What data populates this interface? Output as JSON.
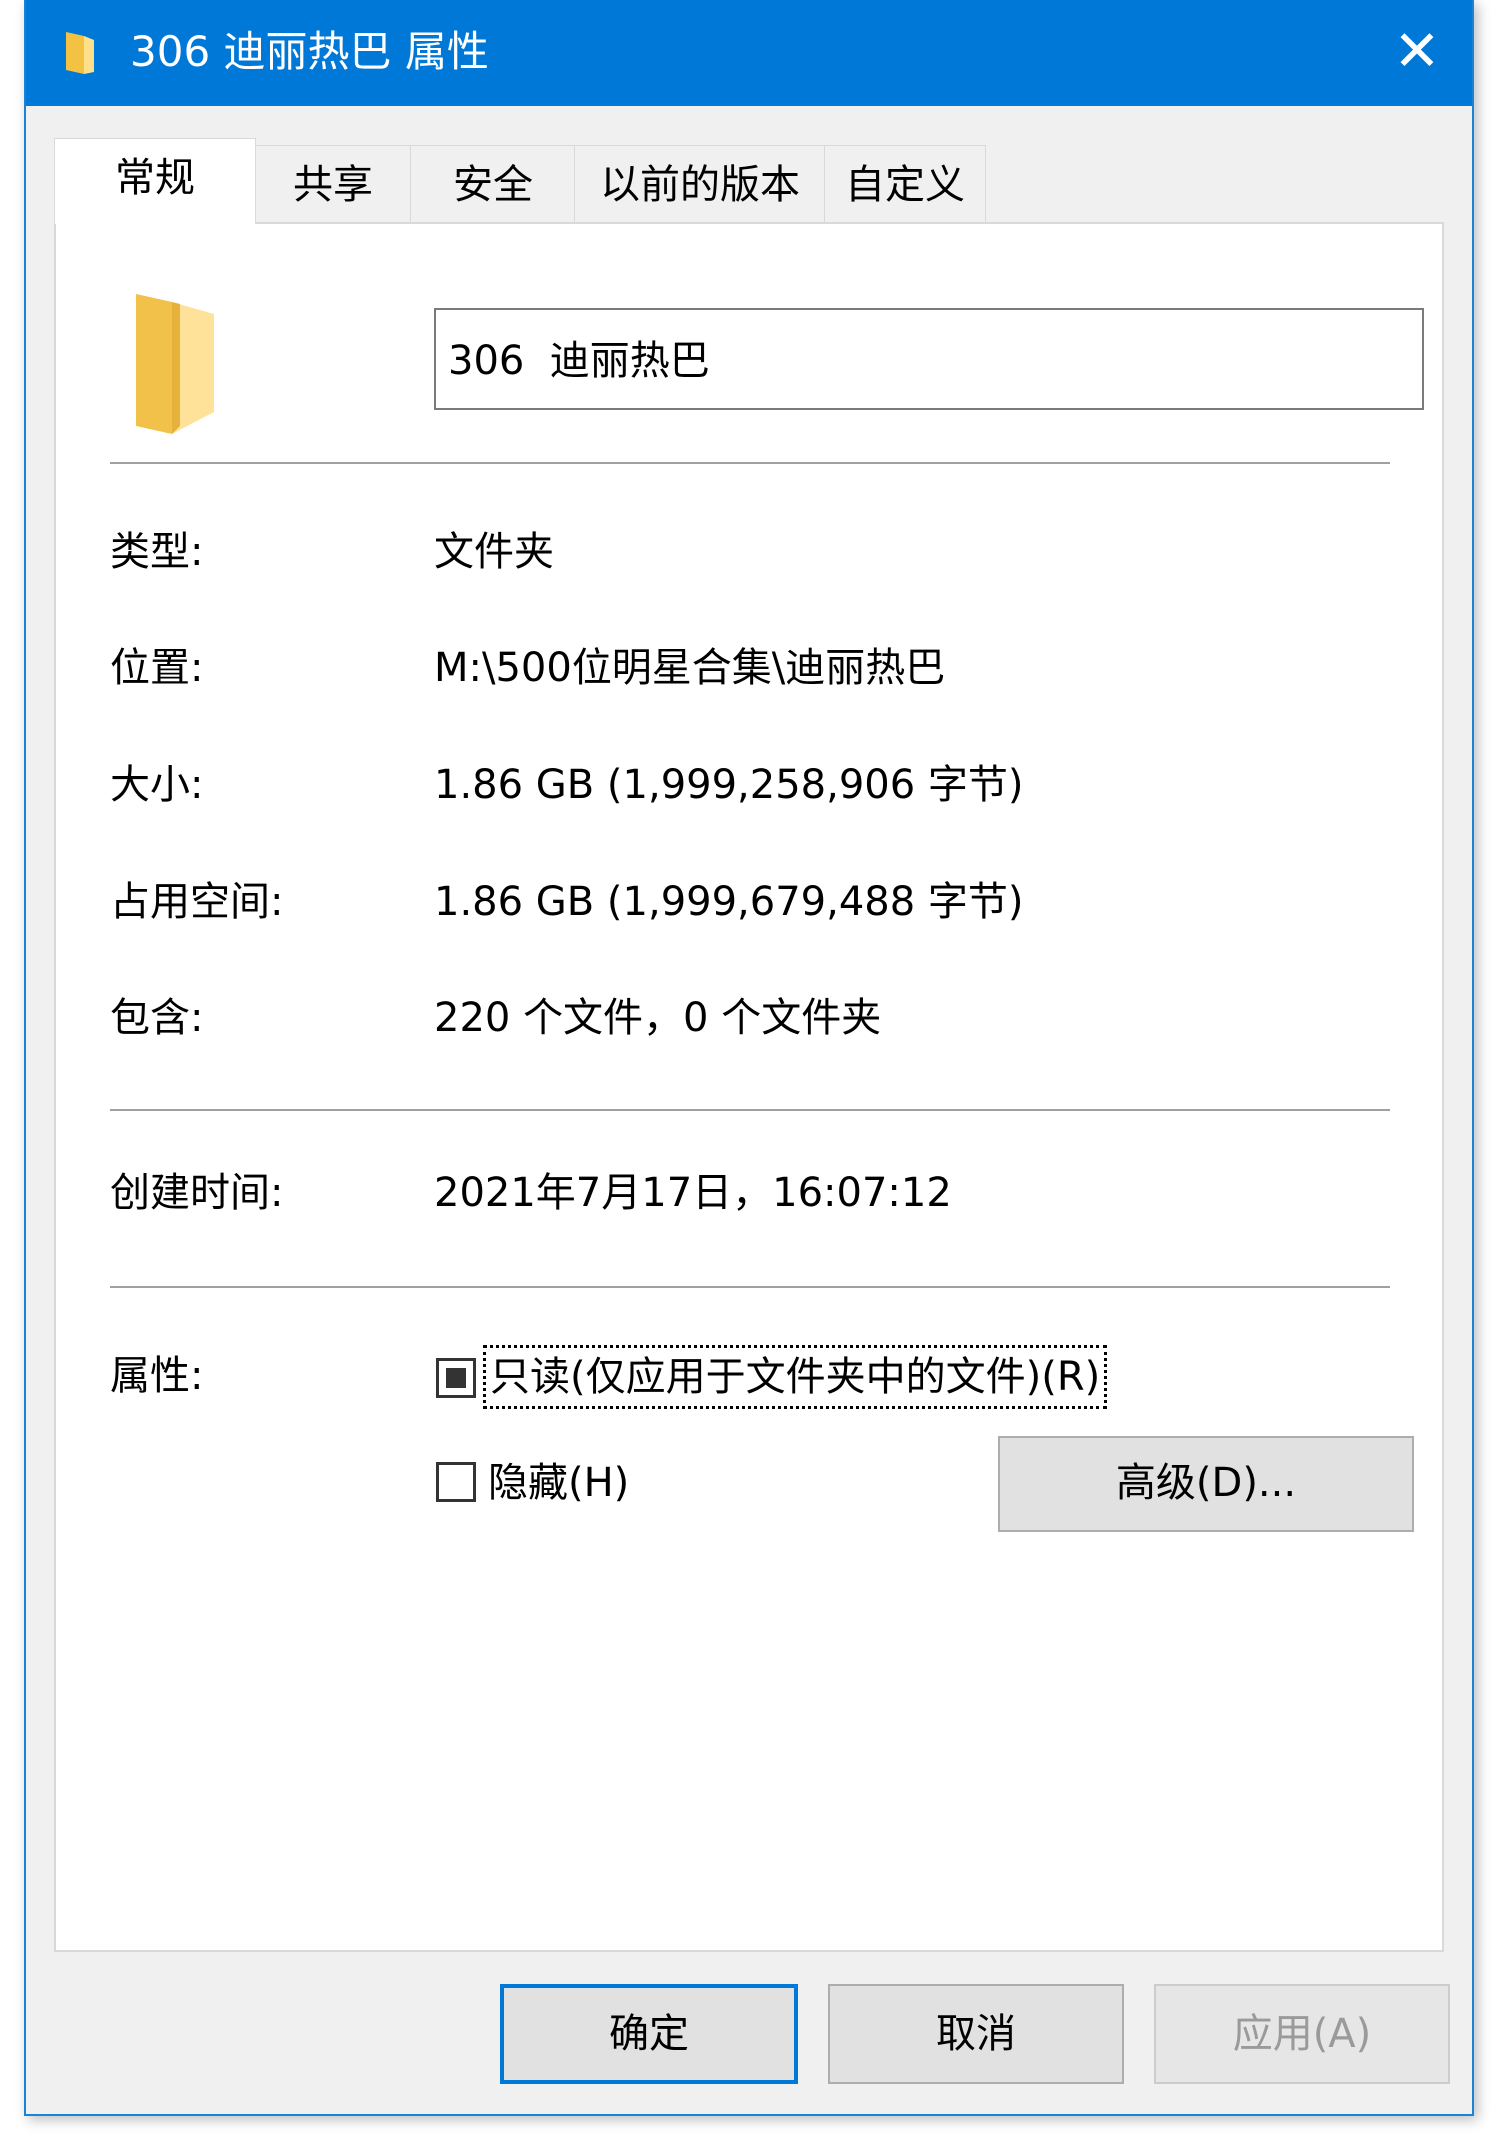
{
  "window": {
    "title": "306  迪丽热巴 属性",
    "close_glyph": "✕",
    "accent_color": "#0078d7"
  },
  "tabs": [
    {
      "label": "常规",
      "active": true
    },
    {
      "label": "共享",
      "active": false
    },
    {
      "label": "安全",
      "active": false
    },
    {
      "label": "以前的版本",
      "active": false
    },
    {
      "label": "自定义",
      "active": false
    }
  ],
  "general": {
    "folder_name": "306  迪丽热巴",
    "rows": [
      {
        "label": "类型:",
        "value": "文件夹"
      },
      {
        "label": "位置:",
        "value": "M:\\500位明星合集\\迪丽热巴"
      },
      {
        "label": "大小:",
        "value": "1.86 GB (1,999,258,906 字节)"
      },
      {
        "label": "占用空间:",
        "value": "1.86 GB (1,999,679,488 字节)"
      },
      {
        "label": "包含:",
        "value": "220 个文件，0 个文件夹"
      }
    ],
    "created_label": "创建时间:",
    "created_value": "2021年7月17日，16:07:12",
    "attributes_label": "属性:",
    "readonly_label": "只读(仅应用于文件夹中的文件)(R)",
    "readonly_state": "indeterminate",
    "hidden_label": "隐藏(H)",
    "hidden_state": "unchecked",
    "advanced_label": "高级(D)..."
  },
  "buttons": {
    "ok": "确定",
    "cancel": "取消",
    "apply": "应用(A)"
  },
  "icons": {
    "title_icon": "folder-icon",
    "large_icon": "folder-icon"
  }
}
